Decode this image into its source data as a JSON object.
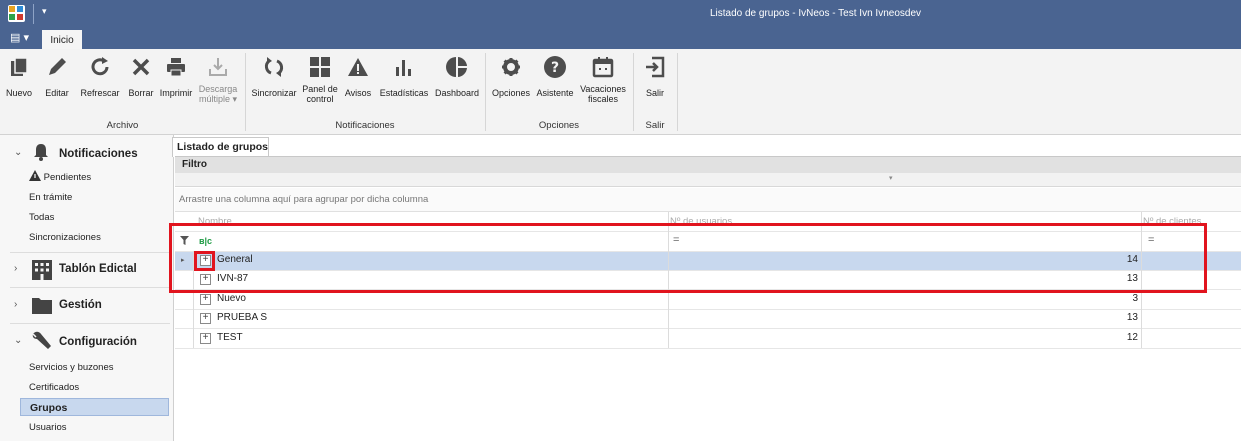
{
  "window": {
    "title": "Listado de grupos - IvNeos - Test Ivn Ivneosdev",
    "qa_menu": "▾"
  },
  "ribbon": {
    "file_menu": "▤ ▾",
    "active_tab": "Inicio",
    "groups": [
      {
        "label": "Archivo",
        "buttons": [
          {
            "label": "Nuevo",
            "icon": "new-doc-icon"
          },
          {
            "label": "Editar",
            "icon": "pencil-icon"
          },
          {
            "label": "Refrescar",
            "icon": "refresh-icon"
          },
          {
            "label": "Borrar",
            "icon": "x-icon"
          },
          {
            "label": "Imprimir",
            "icon": "printer-icon"
          },
          {
            "label": "Descarga múltiple ▾",
            "icon": "download-icon",
            "disabled": true
          }
        ]
      },
      {
        "label": "Notificaciones",
        "buttons": [
          {
            "label": "Sincronizar",
            "icon": "sync-icon"
          },
          {
            "label": "Panel de control",
            "icon": "dashboard-grid-icon"
          },
          {
            "label": "Avisos",
            "icon": "warning-icon"
          },
          {
            "label": "Estadísticas",
            "icon": "bar-chart-icon"
          },
          {
            "label": "Dashboard",
            "icon": "pie-chart-icon"
          }
        ]
      },
      {
        "label": "Opciones",
        "buttons": [
          {
            "label": "Opciones",
            "icon": "gear-icon"
          },
          {
            "label": "Asistente",
            "icon": "help-icon"
          },
          {
            "label": "Vacaciones fiscales",
            "icon": "calendar-icon"
          }
        ]
      },
      {
        "label": "Salir",
        "buttons": [
          {
            "label": "Salir",
            "icon": "exit-icon"
          }
        ]
      }
    ]
  },
  "sidebar": {
    "sections": [
      {
        "title": "Notificaciones",
        "expanded": true,
        "chevron": "⌄",
        "icon": "bell-icon",
        "items": [
          "Pendientes",
          "En trámite",
          "Todas",
          "Sincronizaciones"
        ]
      },
      {
        "title": "Tablón Edictal",
        "expanded": false,
        "chevron": "›",
        "icon": "building-icon",
        "items": []
      },
      {
        "title": "Gestión",
        "expanded": false,
        "chevron": "›",
        "icon": "folder-icon",
        "items": []
      },
      {
        "title": "Configuración",
        "expanded": true,
        "chevron": "⌄",
        "icon": "wrench-icon",
        "items": [
          "Servicios y buzones",
          "Certificados",
          "Grupos",
          "Usuarios"
        ]
      }
    ],
    "selected_item": "Grupos"
  },
  "document": {
    "tab_label": "Listado de grupos",
    "filter_label": "Filtro",
    "collapse_glyph": "▾",
    "group_panel_text": "Arrastre una columna aquí para agrupar por dicha columna"
  },
  "grid": {
    "columns": [
      "Nombre",
      "Nº de usuarios",
      "Nº de clientes"
    ],
    "filter_badge": "ʙ|c",
    "filter_operator": "=",
    "row_indicator": "▸",
    "expander_glyph": "+",
    "rows": [
      {
        "name": "General",
        "users": "14",
        "clients": ""
      },
      {
        "name": "IVN-87",
        "users": "13",
        "clients": ""
      },
      {
        "name": "Nuevo",
        "users": "3",
        "clients": ""
      },
      {
        "name": "PRUEBA S",
        "users": "13",
        "clients": ""
      },
      {
        "name": "TEST",
        "users": "12",
        "clients": ""
      }
    ],
    "selected_row": "General"
  },
  "colors": {
    "titlebar": "#4a6491",
    "selection": "#c8d8ee",
    "highlight": "#e1141e"
  }
}
